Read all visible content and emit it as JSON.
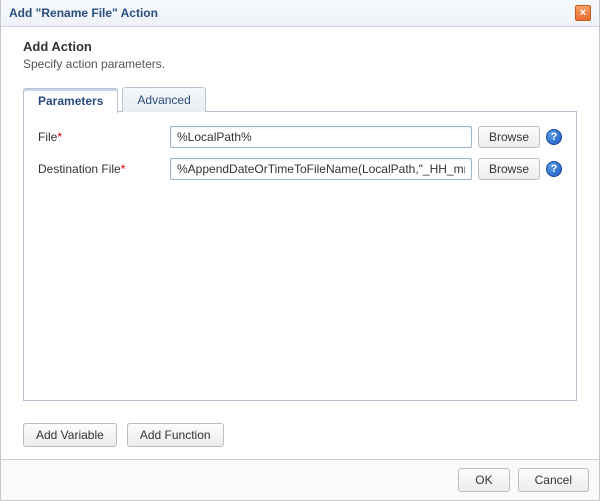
{
  "dialog": {
    "title": "Add \"Rename File\" Action"
  },
  "header": {
    "heading": "Add Action",
    "subheading": "Specify action parameters."
  },
  "tabs": {
    "parameters": "Parameters",
    "advanced": "Advanced"
  },
  "fields": {
    "file": {
      "label": "File",
      "value": "%LocalPath%",
      "browse": "Browse"
    },
    "destFile": {
      "label": "Destination File",
      "value": "%AppendDateOrTimeToFileName(LocalPath,\"_HH_mm",
      "browse": "Browse"
    }
  },
  "buttons": {
    "addVariable": "Add Variable",
    "addFunction": "Add Function",
    "ok": "OK",
    "cancel": "Cancel"
  },
  "icons": {
    "help": "?",
    "close": "×"
  }
}
